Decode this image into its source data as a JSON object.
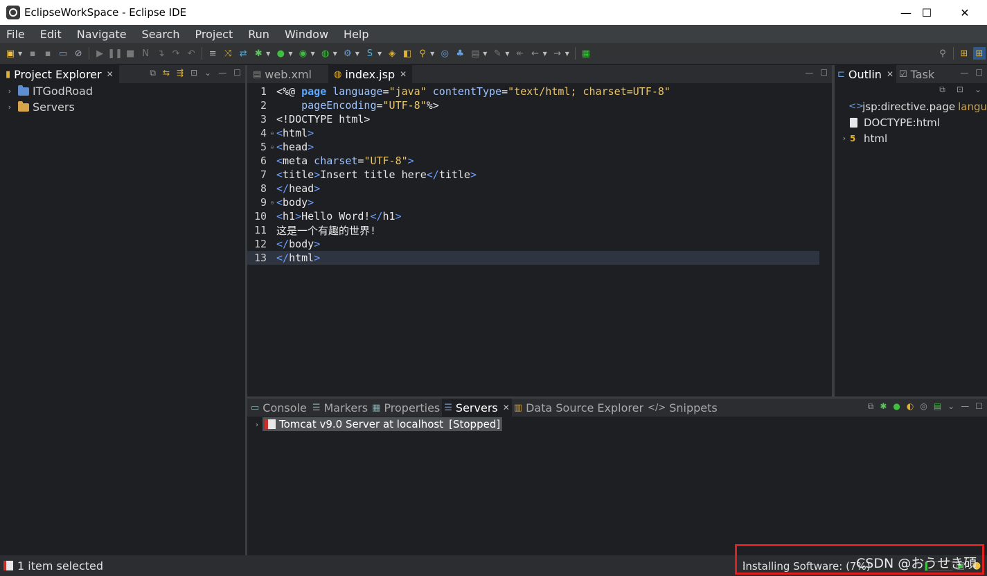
{
  "window": {
    "title": "EclipseWorkSpace - Eclipse IDE",
    "controls": {
      "minimize": "—",
      "maximize": "☐",
      "close": "✕"
    }
  },
  "menu": [
    "File",
    "Edit",
    "Navigate",
    "Search",
    "Project",
    "Run",
    "Window",
    "Help"
  ],
  "project_explorer": {
    "tab_label": "Project Explorer",
    "items": [
      {
        "label": "ITGodRoad",
        "icon": "project-folder-icon"
      },
      {
        "label": "Servers",
        "icon": "folder-icon"
      }
    ]
  },
  "editor": {
    "tabs": [
      {
        "label": "web.xml",
        "active": false
      },
      {
        "label": "index.jsp",
        "active": true
      }
    ],
    "lines": [
      "<%@ page language=\"java\" contentType=\"text/html; charset=UTF-8\"",
      "    pageEncoding=\"UTF-8\"%>",
      "<!DOCTYPE html>",
      "<html>",
      "<head>",
      "<meta charset=\"UTF-8\">",
      "<title>Insert title here</title>",
      "</head>",
      "<body>",
      "<h1>Hello Word!</h1>",
      "这是一个有趣的世界!",
      "</body>",
      "</html>"
    ],
    "current_line": 13
  },
  "outline": {
    "tabs": [
      {
        "label": "Outlin",
        "active": true
      },
      {
        "label": "Task",
        "active": false
      }
    ],
    "items": [
      {
        "label": "jsp:directive.page",
        "suffix": "langu"
      },
      {
        "label": "DOCTYPE:html"
      },
      {
        "label": "html"
      }
    ]
  },
  "bottom_panel": {
    "tabs": [
      {
        "label": "Console",
        "active": false
      },
      {
        "label": "Markers",
        "active": false
      },
      {
        "label": "Properties",
        "active": false
      },
      {
        "label": "Servers",
        "active": true
      },
      {
        "label": "Data Source Explorer",
        "active": false
      },
      {
        "label": "Snippets",
        "active": false
      }
    ],
    "servers": [
      {
        "label": "Tomcat v9.0 Server at localhost",
        "state": "[Stopped]"
      }
    ]
  },
  "status": {
    "selection": "1 item selected",
    "progress_label": "Installing Software: (7%)",
    "progress_fraction": 0.07
  },
  "watermark": "CSDN @おうせき碩",
  "colors": {
    "accent_red": "#e02020",
    "progress_green": "#3fbf3f"
  }
}
